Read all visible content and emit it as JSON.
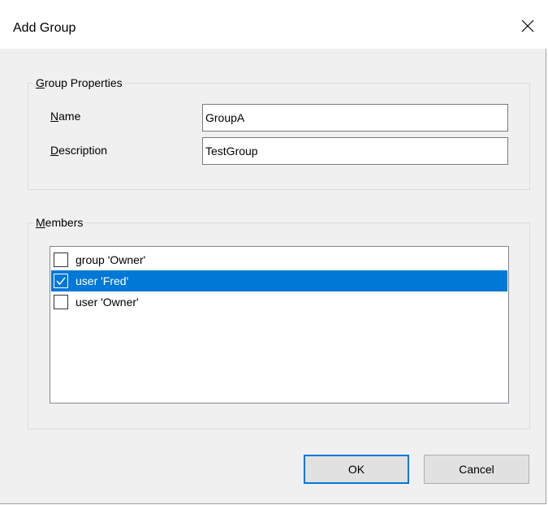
{
  "window": {
    "title": "Add Group"
  },
  "group_properties": {
    "legend_prefix": "G",
    "legend_rest": "roup Properties",
    "name_label_prefix": "N",
    "name_label_rest": "ame",
    "name_value": "GroupA",
    "description_label_prefix": "D",
    "description_label_rest": "escription",
    "description_value": "TestGroup"
  },
  "members": {
    "legend_prefix": "M",
    "legend_rest": "embers",
    "items": [
      {
        "label": "group 'Owner'",
        "checked": false,
        "selected": false
      },
      {
        "label": "user 'Fred'",
        "checked": true,
        "selected": true
      },
      {
        "label": "user 'Owner'",
        "checked": false,
        "selected": false
      }
    ]
  },
  "buttons": {
    "ok": "OK",
    "cancel": "Cancel"
  },
  "icons": {
    "close": "close-icon",
    "check": "checkmark-icon"
  },
  "colors": {
    "selection": "#0078d7",
    "dialog_bg": "#f0f0f0"
  }
}
